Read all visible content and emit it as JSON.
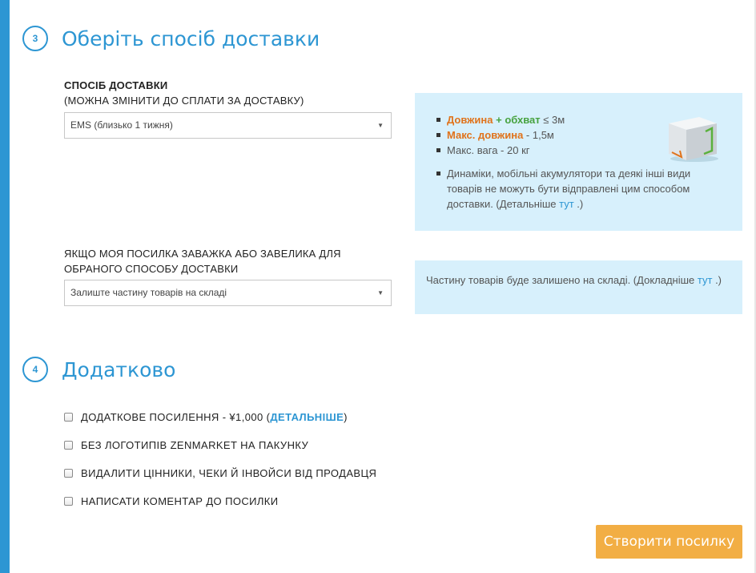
{
  "step3": {
    "number": "3",
    "title": "Оберіть спосіб доставки",
    "shipping_label": "СПОСІБ ДОСТАВКИ",
    "shipping_hint": "(МОЖНА ЗМІНИТИ ДО СПЛАТИ ЗА ДОСТАВКУ)",
    "shipping_select": "EMS (близько 1 тижня)",
    "overweight_label_line1": "ЯКЩО МОЯ ПОСИЛКА ЗАВАЖКА АБО ЗАВЕЛИКА ДЛЯ",
    "overweight_label_line2": "ОБРАНОГО СПОСОБУ ДОСТАВКИ",
    "overweight_select": "Залиште частину товарів на складі",
    "info": {
      "length_label": "Довжина",
      "plus": " + ",
      "girth_label": "обхват",
      "length_girth_value": " ≤ 3м",
      "max_length_label": "Макс. довжина",
      "max_length_value": " -  1,5м",
      "max_weight": "Макс. вага - 20 кг",
      "note": "Динаміки, мобільні акумулятори та деякі інші види товарів не можуть бути відправлені цим способом доставки. (Детальніше ",
      "note_link": "тут",
      "note_end": " .)",
      "box_icon": "package-box-icon"
    },
    "overweight_info": "Частину товарів буде залишено на складі. (Докладніше ",
    "overweight_info_link": "тут",
    "overweight_info_end": " .)"
  },
  "step4": {
    "number": "4",
    "title": "Додатково",
    "options": [
      {
        "label": "ДОДАТКОВЕ ПОСИЛЕННЯ - ¥1,000 (",
        "link": "ДЕТАЛЬНІШЕ",
        "end": ")"
      },
      {
        "label": "БЕЗ ЛОГОТИПІВ ZENMARKET НА ПАКУНКУ"
      },
      {
        "label": "ВИДАЛИТИ ЦІННИКИ, ЧЕКИ Й ІНВОЙСИ ВІД ПРОДАВЦЯ"
      },
      {
        "label": "НАПИСАТИ КОМЕНТАР ДО ПОСИЛКИ"
      }
    ]
  },
  "submit_label": "Створити посилку",
  "colors": {
    "accent": "#2d96d3",
    "info_bg": "#d7f0fc",
    "orange": "#e0731b",
    "green": "#47a23f",
    "button": "#f2ae44"
  }
}
